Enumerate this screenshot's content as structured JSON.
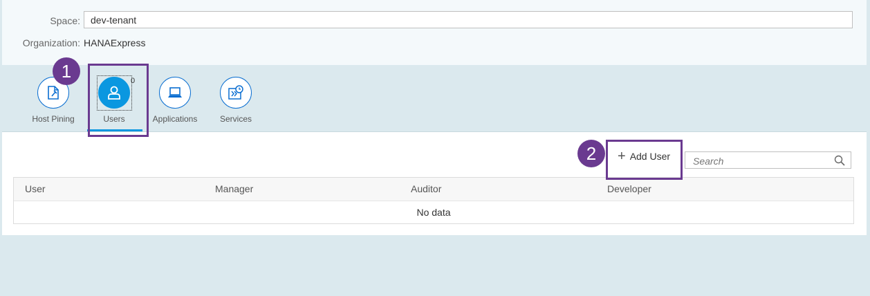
{
  "form": {
    "space_label": "Space:",
    "space_value": "dev-tenant",
    "org_label": "Organization:",
    "org_value": "HANAExpress"
  },
  "tabs": [
    {
      "label": "Host Pining",
      "icon": "pin-document-icon"
    },
    {
      "label": "Users",
      "icon": "user-icon",
      "count": "0",
      "selected": true
    },
    {
      "label": "Applications",
      "icon": "laptop-icon"
    },
    {
      "label": "Services",
      "icon": "service-clock-icon"
    }
  ],
  "annotations": {
    "step1": "1",
    "step2": "2",
    "color": "#6a3a90"
  },
  "toolbar": {
    "add_user_label": "Add User",
    "search_placeholder": "Search"
  },
  "table": {
    "columns": [
      "User",
      "Manager",
      "Auditor",
      "Developer"
    ],
    "empty_text": "No data"
  },
  "colors": {
    "accent": "#0a97e0",
    "background": "#dbe9ee"
  }
}
